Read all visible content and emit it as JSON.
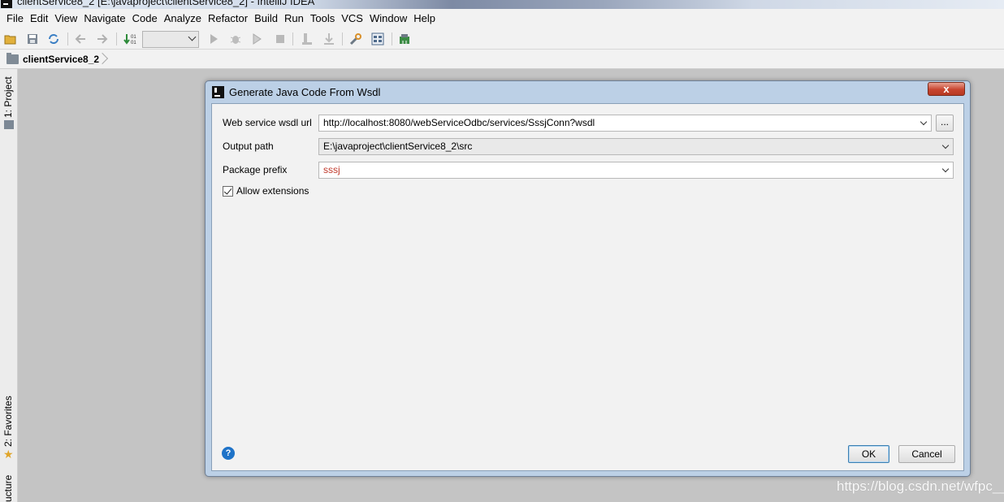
{
  "window": {
    "title": "clientService8_2 [E:\\javaproject\\clientService8_2] - IntelliJ IDEA"
  },
  "menu": [
    "File",
    "Edit",
    "View",
    "Navigate",
    "Code",
    "Analyze",
    "Refactor",
    "Build",
    "Run",
    "Tools",
    "VCS",
    "Window",
    "Help"
  ],
  "breadcrumb": {
    "project": "clientService8_2"
  },
  "side_tabs": {
    "project": "1: Project",
    "favorites": "2: Favorites",
    "structure": "ucture"
  },
  "dialog": {
    "title": "Generate Java Code From Wsdl",
    "close_label": "x",
    "fields": {
      "wsdl_label": "Web service wsdl url",
      "wsdl_value": "http://localhost:8080/webServiceOdbc/services/SssjConn?wsdl",
      "browse_label": "...",
      "output_label": "Output path",
      "output_value": "E:\\javaproject\\clientService8_2\\src",
      "package_label": "Package prefix",
      "package_value": "sssj"
    },
    "checkbox": {
      "label": "Allow extensions",
      "checked": true
    },
    "help_label": "?",
    "ok_label": "OK",
    "cancel_label": "Cancel"
  },
  "colors": {
    "package_text": "#c0392b",
    "help_blue": "#1f73c8",
    "close_red": "#c8452f"
  },
  "watermark": "https://blog.csdn.net/wfpc__"
}
